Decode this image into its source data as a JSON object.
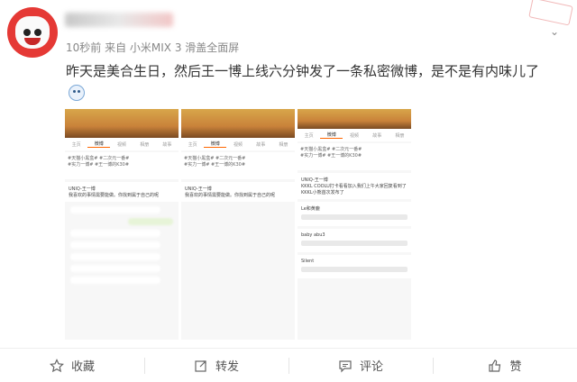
{
  "post": {
    "meta": "10秒前 来自 小米MIX 3 滑盖全面屏",
    "text": "昨天是美合生日，然后王一博上线六分钟发了一条私密微博，是不是有内味儿了"
  },
  "screenshots": [
    {
      "tabs": [
        "主页",
        "微博",
        "视频",
        "相册",
        "故事"
      ],
      "tags": [
        "#天猫小黑盒#",
        "#二次元一番#",
        "#实力一博#",
        "#王一博的K30#"
      ],
      "author": "UNIQ-王一博",
      "post": "我喜欢的事情需要能做。你找到属于自己的呢"
    },
    {
      "tabs": [
        "主页",
        "微博",
        "视频",
        "故事",
        "相册"
      ],
      "tags": [
        "#天猫小黑盒#",
        "#二次元一番#",
        "#实力一博#",
        "#王一博的K30#"
      ],
      "author": "UNIQ-王一博",
      "post": "我喜欢的事情需要能做。你找到属于自己的呢"
    },
    {
      "tabs": [
        "主页",
        "微博",
        "视频",
        "故事",
        "相册"
      ],
      "tags": [
        "#天猫小黑盒#",
        "#二次元一番#",
        "#实力一博#",
        "#王一博的K30#"
      ],
      "author": "UNIQ-王一博",
      "post": "KKKL COOLU打卡看看加入我们上午大家回复看到了 KKKL小熊首次发布了",
      "comments": [
        "Le和黄鹿",
        "baby abu3",
        "Silent"
      ]
    }
  ],
  "actions": {
    "favorite": "收藏",
    "repost": "转发",
    "comment": "评论",
    "like": "赞"
  },
  "colors": {
    "avatar_red": "#e53935",
    "accent_orange": "#ff6600"
  }
}
